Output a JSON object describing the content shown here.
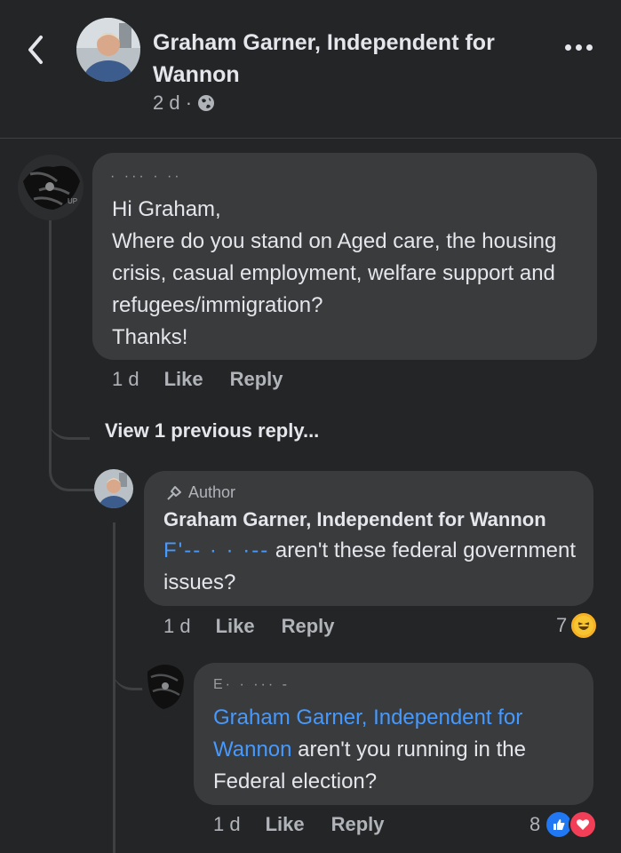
{
  "header": {
    "title": "Graham Garner, Independent for Wannon",
    "time": "2 d ·",
    "more_label": "More options"
  },
  "comments": [
    {
      "author_redacted": "· ··· · ··",
      "text": "Hi Graham,\nWhere do you stand on Aged care, the housing crisis, casual employment, welfare support and refugees/immigration?\nThanks!",
      "time": "1 d",
      "like": "Like",
      "reply": "Reply"
    }
  ],
  "view_previous": "View 1 previous reply...",
  "reply1": {
    "author_badge": "Author",
    "author": "Graham Garner, Independent for Wannon",
    "mention_redacted": "F'‐‐ · · ·‐‐",
    "text": " aren't these federal government issues?",
    "time": "1 d",
    "like": "Like",
    "reply": "Reply",
    "reaction_count": "7",
    "reaction_emoji": "😆"
  },
  "reply2": {
    "author_redacted": "E· · ··· ‐",
    "mention": "Graham Garner, Independent for Wannon",
    "text": " aren't you running in the Federal election?",
    "time": "1 d",
    "like": "Like",
    "reply": "Reply",
    "reaction_count": "8",
    "like_icon": "👍",
    "heart_icon": "❤"
  },
  "colors": {
    "background": "#242526",
    "bubble": "#3a3b3c",
    "link": "#4599ff",
    "meta": "#b0b3b8"
  }
}
